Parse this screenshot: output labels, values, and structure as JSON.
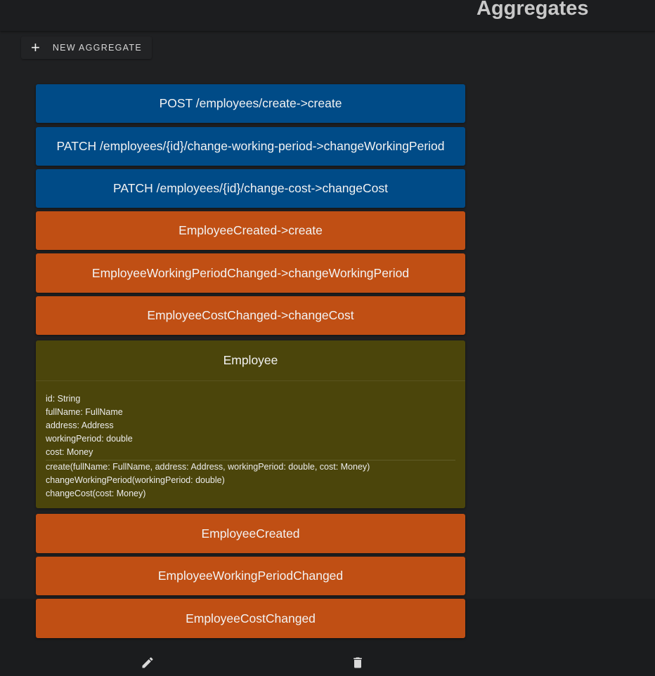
{
  "header": {
    "title": "Aggregates"
  },
  "toolbar": {
    "new_icon": "plus-icon",
    "new_label": "NEW AGGREGATE"
  },
  "commands": [
    {
      "label": "POST /employees/create->create"
    },
    {
      "label": "PATCH /employees/{id}/change-working-period->changeWorkingPeriod"
    },
    {
      "label": "PATCH /employees/{id}/change-cost->changeCost"
    }
  ],
  "event_handlers": [
    {
      "label": "EmployeeCreated->create"
    },
    {
      "label": "EmployeeWorkingPeriodChanged->changeWorkingPeriod"
    },
    {
      "label": "EmployeeCostChanged->changeCost"
    }
  ],
  "aggregate": {
    "name": "Employee",
    "fields": [
      "id: String",
      "fullName: FullName",
      "address: Address",
      "workingPeriod: double",
      "cost: Money"
    ],
    "methods": [
      "create(fullName: FullName, address: Address, workingPeriod: double, cost: Money)",
      "changeWorkingPeriod(workingPeriod: double)",
      "changeCost(cost: Money)"
    ]
  },
  "events": [
    {
      "label": "EmployeeCreated"
    },
    {
      "label": "EmployeeWorkingPeriodChanged"
    },
    {
      "label": "EmployeeCostChanged"
    }
  ],
  "actions": {
    "edit_icon": "pencil-icon",
    "delete_icon": "trash-icon"
  },
  "colors": {
    "command": "#004b87",
    "event": "#c04f14",
    "aggregate": "#4b450b",
    "background": "#1f2022"
  }
}
